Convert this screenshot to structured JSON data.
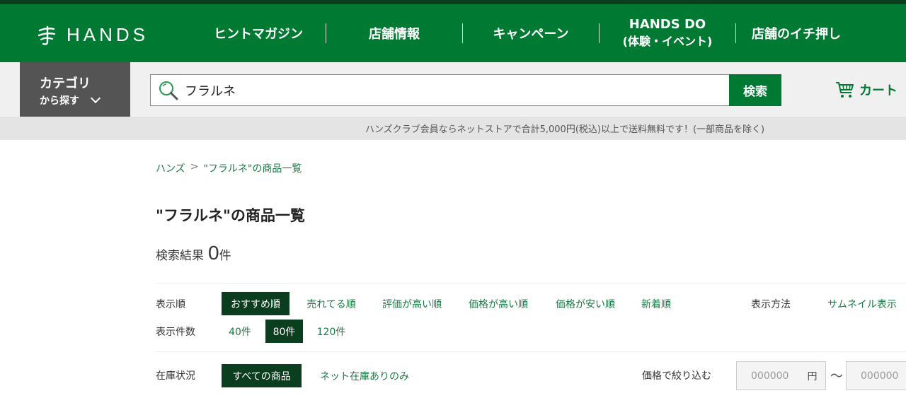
{
  "header": {
    "logo_text": "HANDS",
    "nav": [
      {
        "label": "ヒントマガジン"
      },
      {
        "label": "店舗情報"
      },
      {
        "label": "キャンペーン"
      },
      {
        "label": "HANDS DO",
        "sub": "(体験・イベント)"
      },
      {
        "label": "店舗のイチ押し"
      }
    ]
  },
  "search": {
    "category_line1": "カテゴリ",
    "category_line2": "から探す",
    "query": "フラルネ",
    "button_label": "検索",
    "cart_label": "カート"
  },
  "notice": "ハンズクラブ会員ならネットストアで合計5,000円(税込)以上で送料無料です！(一部商品を除く)",
  "breadcrumb": {
    "home": "ハンズ",
    "separator": ">",
    "current": "\"フラルネ\"の商品一覧"
  },
  "page_title": "\"フラルネ\"の商品一覧",
  "results": {
    "label": "検索結果",
    "count": "0",
    "unit": "件"
  },
  "sort": {
    "label": "表示順",
    "options": [
      "おすすめ順",
      "売れてる順",
      "評価が高い順",
      "価格が高い順",
      "価格が安い順",
      "新着順"
    ],
    "selected": "おすすめ順"
  },
  "display": {
    "label": "表示方法",
    "option": "サムネイル表示"
  },
  "per_page": {
    "label": "表示件数",
    "options": [
      "40件",
      "80件",
      "120件"
    ],
    "selected": "80件"
  },
  "stock": {
    "label": "在庫状況",
    "options": [
      "すべての商品",
      "ネット在庫ありのみ"
    ],
    "selected": "すべての商品"
  },
  "price_filter": {
    "label": "価格で絞り込む",
    "min_placeholder": "000000",
    "max_placeholder": "000000",
    "currency": "円",
    "range_sep": "〜"
  },
  "colors": {
    "brand_green": "#007a33",
    "dark_green": "#0b3d1f",
    "link_green": "#1a7a44"
  }
}
